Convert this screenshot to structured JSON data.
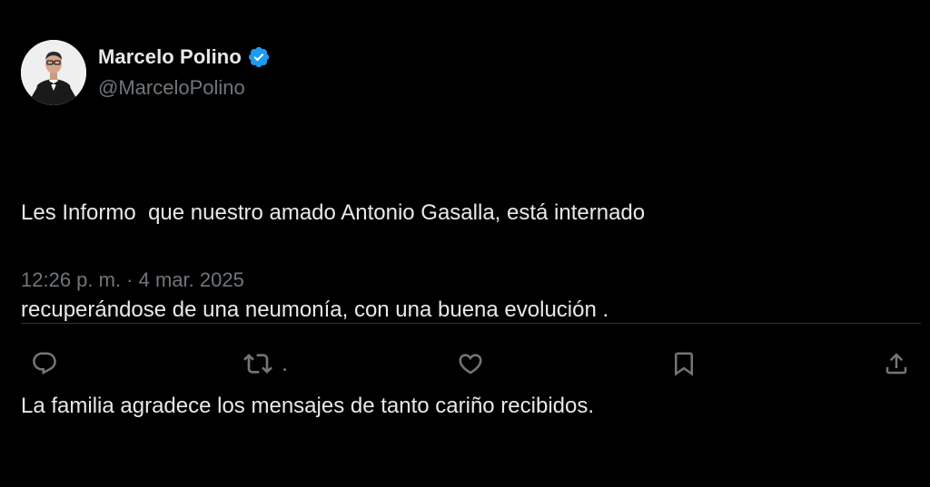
{
  "author": {
    "display_name": "Marcelo Polino",
    "handle": "@MarceloPolino",
    "verified": true,
    "verified_color": "#1d9bf0"
  },
  "tweet": {
    "text_lines": [
      "Les Informo  que nuestro amado Antonio Gasalla, está internado",
      "recuperándose de una neumonía, con una buena evolución .",
      "La familia agradece los mensajes de tanto cariño recibidos."
    ],
    "timestamp": "12:26 p. m. · 4 mar. 2025"
  },
  "actions": [
    {
      "name": "reply",
      "icon": "reply-icon"
    },
    {
      "name": "retweet",
      "icon": "retweet-icon"
    },
    {
      "name": "like",
      "icon": "heart-icon"
    },
    {
      "name": "bookmark",
      "icon": "bookmark-icon"
    },
    {
      "name": "share",
      "icon": "share-icon"
    }
  ],
  "colors": {
    "background": "#000000",
    "primary_text": "#e7e9ea",
    "secondary_text": "#71767b",
    "divider": "#2f3336",
    "accent": "#1d9bf0"
  }
}
